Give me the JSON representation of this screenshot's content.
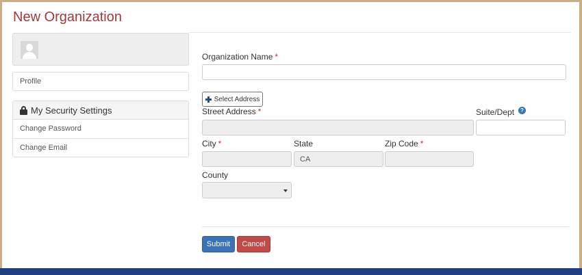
{
  "page": {
    "title": "New Organization"
  },
  "sidebar": {
    "profile_label": "Profile",
    "security": {
      "heading": "My Security Settings",
      "items": [
        {
          "label": "Change Password"
        },
        {
          "label": "Change Email"
        }
      ]
    }
  },
  "form": {
    "org_name": {
      "label": "Organization Name",
      "required": "*",
      "value": ""
    },
    "select_address_label": "Select Address",
    "street": {
      "label": "Street Address",
      "required": "*",
      "value": ""
    },
    "suite": {
      "label": "Suite/Dept",
      "help_icon": "?",
      "value": ""
    },
    "city": {
      "label": "City",
      "required": "*",
      "value": ""
    },
    "state": {
      "label": "State",
      "value": "CA"
    },
    "zip": {
      "label": "Zip Code",
      "required": "*",
      "value": ""
    },
    "county": {
      "label": "County",
      "selected": ""
    }
  },
  "actions": {
    "submit_label": "Submit",
    "cancel_label": "Cancel"
  },
  "colors": {
    "title": "#a33a3a",
    "submit": "#3a72b7",
    "cancel": "#c44a47",
    "footer": "#1f3e82",
    "frame": "#c9ae86"
  }
}
